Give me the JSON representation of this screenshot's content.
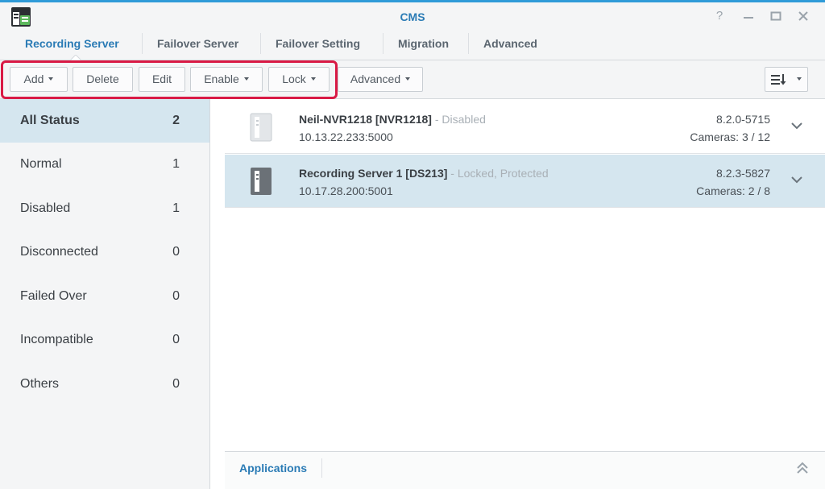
{
  "window": {
    "title": "CMS",
    "controls": [
      "help-icon",
      "minimize-icon",
      "maximize-icon",
      "close-icon"
    ]
  },
  "tabs": [
    {
      "label": "Recording Server",
      "active": true
    },
    {
      "label": "Failover Server",
      "active": false
    },
    {
      "label": "Failover Setting",
      "active": false
    },
    {
      "label": "Migration",
      "active": false
    },
    {
      "label": "Advanced",
      "active": false
    }
  ],
  "toolbar": {
    "add_label": "Add",
    "delete_label": "Delete",
    "edit_label": "Edit",
    "enable_label": "Enable",
    "lock_label": "Lock",
    "advanced_label": "Advanced",
    "sort_icon": "sort-list-icon",
    "highlight_color": "#d91a45"
  },
  "sidebar": {
    "items": [
      {
        "label": "All Status",
        "count": "2",
        "active": true
      },
      {
        "label": "Normal",
        "count": "1"
      },
      {
        "label": "Disabled",
        "count": "1"
      },
      {
        "label": "Disconnected",
        "count": "0"
      },
      {
        "label": "Failed Over",
        "count": "0"
      },
      {
        "label": "Incompatible",
        "count": "0"
      },
      {
        "label": "Others",
        "count": "0"
      }
    ]
  },
  "servers": [
    {
      "name": "Neil-NVR1218 [NVR1218]",
      "status": " - Disabled",
      "address": "10.13.22.233:5000",
      "version": "8.2.0-5715",
      "cameras": "Cameras: 3 / 12",
      "selected": false
    },
    {
      "name": "Recording Server 1 [DS213]",
      "status": " - Locked, Protected",
      "address": "10.17.28.200:5001",
      "version": "8.2.3-5827",
      "cameras": "Cameras: 2 / 8",
      "selected": true
    }
  ],
  "footer": {
    "tab_label": "Applications"
  },
  "colors": {
    "accent": "#2a7bb5",
    "selected_bg": "#d5e6ef",
    "panel_bg": "#f4f5f6"
  }
}
